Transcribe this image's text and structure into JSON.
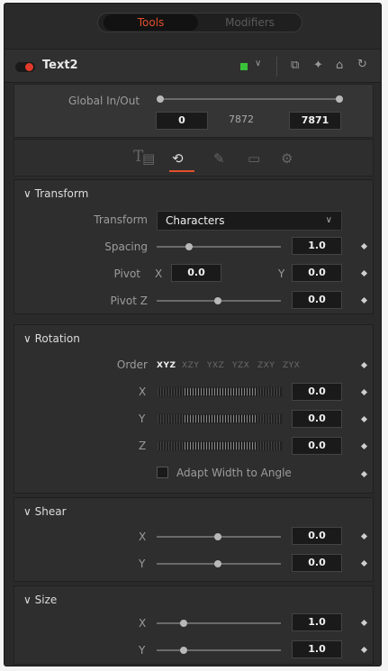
{
  "tabs": {
    "tools": "Tools",
    "modifiers": "Modifiers"
  },
  "node": {
    "name": "Text2",
    "color_chip": "#3ac23a"
  },
  "global": {
    "label": "Global In/Out",
    "in": "0",
    "mid": "7872",
    "out": "7871"
  },
  "icons": [
    "text-icon",
    "layout-icon",
    "transform-icon",
    "shading-icon",
    "image-icon",
    "settings-icon"
  ],
  "transform": {
    "title": "Transform",
    "mode_label": "Transform",
    "mode_value": "Characters",
    "spacing_label": "Spacing",
    "spacing_value": "1.0",
    "pivot_label": "Pivot",
    "pivot_x_label": "X",
    "pivot_x": "0.0",
    "pivot_y_label": "Y",
    "pivot_y": "0.0",
    "pivot_z_label": "Pivot Z",
    "pivot_z": "0.0"
  },
  "rotation": {
    "title": "Rotation",
    "order_label": "Order",
    "orders": [
      "XYZ",
      "XZY",
      "YXZ",
      "YZX",
      "ZXY",
      "ZYX"
    ],
    "x_label": "X",
    "x": "0.0",
    "y_label": "Y",
    "y": "0.0",
    "z_label": "Z",
    "z": "0.0",
    "adapt_label": "Adapt Width to Angle"
  },
  "shear": {
    "title": "Shear",
    "x_label": "X",
    "x": "0.0",
    "y_label": "Y",
    "y": "0.0"
  },
  "size": {
    "title": "Size",
    "x_label": "X",
    "x": "1.0",
    "y_label": "Y",
    "y": "1.0"
  }
}
